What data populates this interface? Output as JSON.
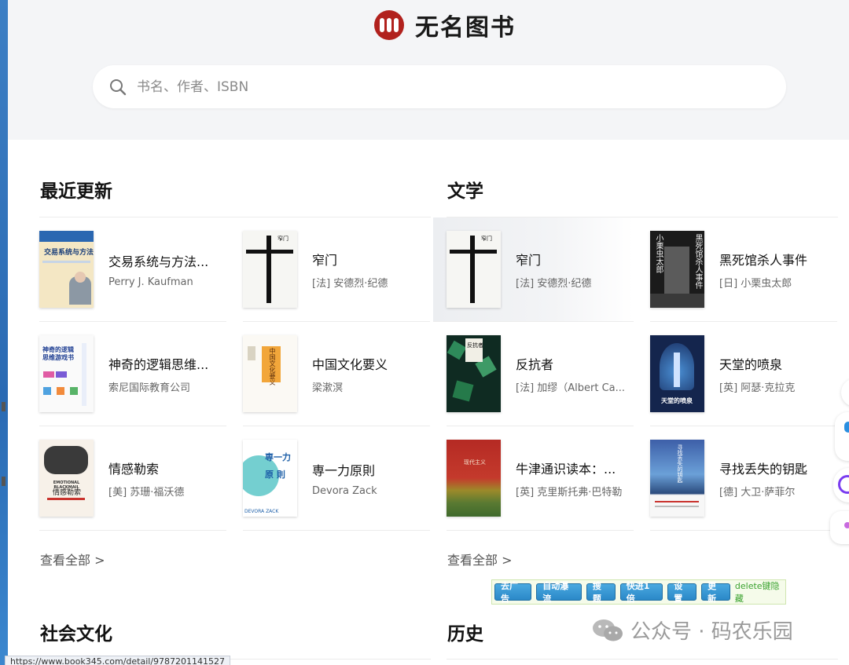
{
  "header": {
    "brand_title": "无名图书",
    "search_placeholder": "书名、作者、ISBN"
  },
  "sections": [
    {
      "title": "最近更新",
      "view_all": "查看全部 >",
      "books": [
        {
          "title": "交易系统与方法...",
          "author": "Perry J. Kaufman"
        },
        {
          "title": "窄门",
          "author": "[法] 安德烈·纪德"
        },
        {
          "title": "神奇的逻辑思维...",
          "author": "索尼国际教育公司"
        },
        {
          "title": "中国文化要义",
          "author": "梁漱溟"
        },
        {
          "title": "情感勒索",
          "author": "[美] 苏珊·福沃德"
        },
        {
          "title": "専一力原則",
          "author": "Devora Zack"
        }
      ]
    },
    {
      "title": "文学",
      "view_all": "查看全部 >",
      "books": [
        {
          "title": "窄门",
          "author": "[法] 安德烈·纪德"
        },
        {
          "title": "黑死馆杀人事件",
          "author": "[日] 小栗虫太郎"
        },
        {
          "title": "反抗者",
          "author": "[法] 加缪（Albert Ca..."
        },
        {
          "title": "天堂的喷泉",
          "author": "[英] 阿瑟·克拉克"
        },
        {
          "title": "牛津通识读本：...",
          "author": "[英] 克里斯托弗·巴特勒"
        },
        {
          "title": "寻找丢失的钥匙",
          "author": "[德] 大卫·萨菲尔"
        }
      ]
    },
    {
      "title": "社会文化"
    },
    {
      "title": "历史"
    }
  ],
  "covers": {
    "c1_title": "交易系统与方法",
    "c2_title": "窄门",
    "c3_title": "神奇的逻辑思维游戏书",
    "c4_title": "中国文化要义",
    "c5_title": "情感勒索",
    "c5_en": "EMOTIONAL BLACKMAIL",
    "c6_title": "専一力 原 則",
    "c6_en": "DEVORA ZACK",
    "c8_title": "黑死馆杀人事件",
    "c8_author": "小栗虫太郎",
    "c9_title": "反抗者",
    "c10_title": "天堂的喷泉",
    "c11_title": "现代主义",
    "c12_title": "寻找丢失的钥匙"
  },
  "adbar": {
    "buttons": [
      "去广告",
      "自动瀑流",
      "搜题",
      "快进1倍",
      "设置",
      "更新"
    ],
    "text": "delete键隐藏"
  },
  "watermark": "公众号 · 码农乐园",
  "status_url": "https://www.book345.com/detail/9787201141527",
  "colors": {
    "brand_red": "#b1211d",
    "bg_header": "#f4f5f7"
  }
}
